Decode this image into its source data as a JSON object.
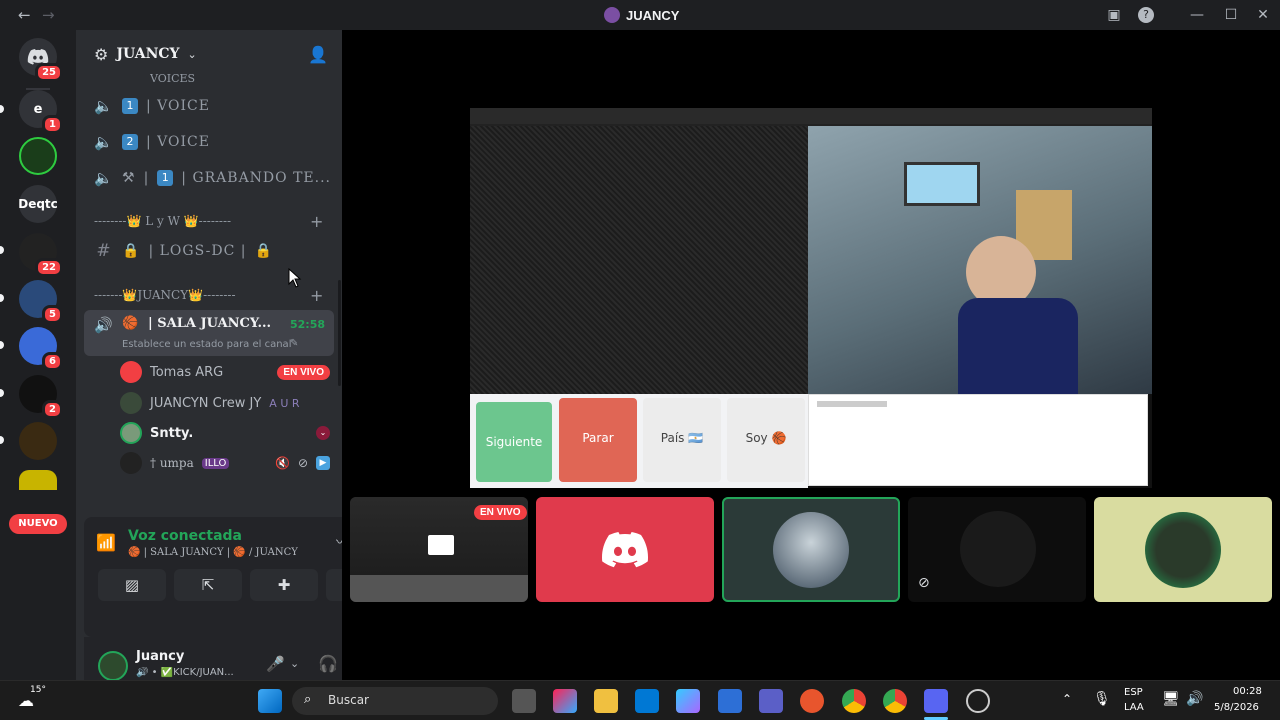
{
  "window": {
    "title": "JUANCY"
  },
  "rail": {
    "home_badge": "25",
    "servers": [
      {
        "label": "e",
        "badge": "1"
      },
      {
        "label": "",
        "badge": ""
      },
      {
        "label": "Deqtc",
        "badge": ""
      },
      {
        "label": "",
        "badge": "22"
      },
      {
        "label": "",
        "badge": "5"
      },
      {
        "label": "",
        "badge": "6"
      },
      {
        "label": "",
        "badge": "2"
      },
      {
        "label": "",
        "badge": ""
      }
    ],
    "new_label": "NUEVO"
  },
  "server": {
    "name": "JUANCY"
  },
  "channels": {
    "partial_top": "VOICES",
    "voice1": "| VOICE",
    "voice1_num": "1",
    "voice2": "| VOICE",
    "voice2_num": "2",
    "grabando_num": "1",
    "grabando": "| GRABANDO TE...",
    "cat_lyw": "--------👑 L y W 👑--------",
    "logs": "| LOGS-DC |",
    "cat_juancy": "-------👑JUANCY👑--------",
    "active_name": "| SALA JUANCY...",
    "active_time": "52:58",
    "active_status": "Establece un estado para el canal"
  },
  "voice_users": [
    {
      "name": "Tomas ARG",
      "tag": "EN VIVO"
    },
    {
      "name": "JUANCYN Crew JY",
      "tag": "A U R"
    },
    {
      "name": "Sntty.",
      "tag": ""
    },
    {
      "name": "† umpa",
      "tag": "ILLO"
    }
  ],
  "voice_panel": {
    "status": "Voz conectada",
    "location": "🏀 | SALA JUANCY | 🏀 / JUANCY"
  },
  "user_panel": {
    "name": "Juancy",
    "status": "🔊 • ✅KICK/JUAN..."
  },
  "stream": {
    "buttons": [
      "Siguiente",
      "Parar",
      "País 🇦🇷",
      "Soy 🏀"
    ],
    "live_badge": "EN VIVO"
  },
  "taskbar": {
    "weather": "15°",
    "search_placeholder": "Buscar",
    "lang1": "ESP",
    "lang2": "LAA",
    "time": "00:28",
    "date": "5/8/2026"
  },
  "colors": {
    "accent": "#5865f2",
    "live_red": "#f23f43",
    "voice_green": "#23a559",
    "tile_red": "#e03a4c",
    "tile_beige": "#d9dca0"
  }
}
